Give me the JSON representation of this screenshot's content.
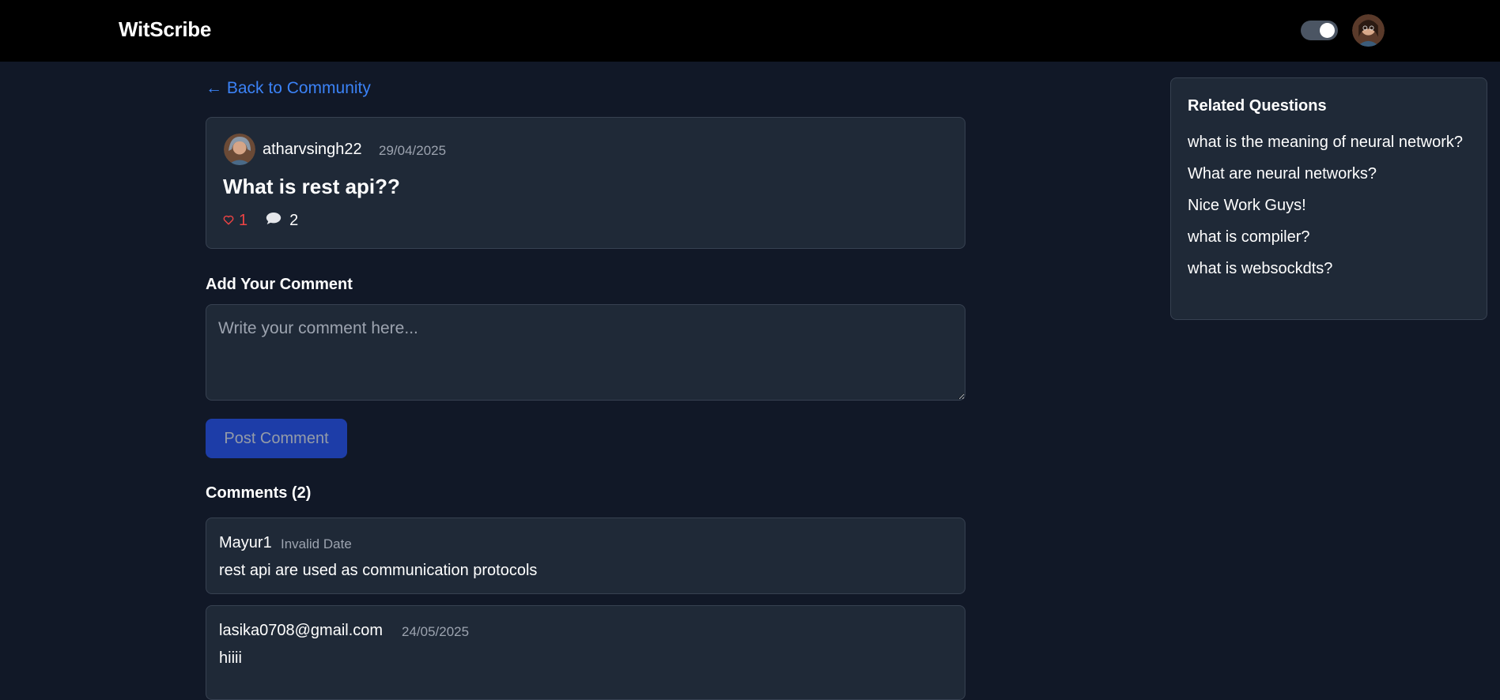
{
  "app": {
    "brand": "WitScribe"
  },
  "nav": {
    "back_label": "← Back to Community"
  },
  "post": {
    "author": "atharvsingh22",
    "date": "29/04/2025",
    "title": "What is rest api??",
    "likes": "1",
    "comments_count": "2"
  },
  "comment_form": {
    "heading": "Add Your Comment",
    "placeholder": "Write your comment here...",
    "submit_label": "Post Comment"
  },
  "comments": {
    "heading": "Comments (2)",
    "items": [
      {
        "author": "Mayur1",
        "date": "Invalid Date",
        "text": "rest api are used as communication protocols"
      },
      {
        "author": "lasika0708@gmail.com",
        "date": "24/05/2025",
        "text": "hiiii"
      }
    ]
  },
  "related": {
    "heading": "Related Questions",
    "items": [
      "what is the meaning of neural network?",
      "What are neural networks?",
      "Nice Work Guys!",
      "what is compiler?",
      "what is websockdts?"
    ]
  },
  "colors": {
    "background": "#111827",
    "navbar": "#000000",
    "card": "#1f2937",
    "accent_link": "#3b82f6",
    "button": "#1e40af",
    "like": "#ef4444",
    "muted_text": "#9ca3af"
  },
  "icons": {
    "like": "heart-outline-icon",
    "comment": "speech-bubble-icon",
    "theme_toggle": "toggle-switch"
  }
}
